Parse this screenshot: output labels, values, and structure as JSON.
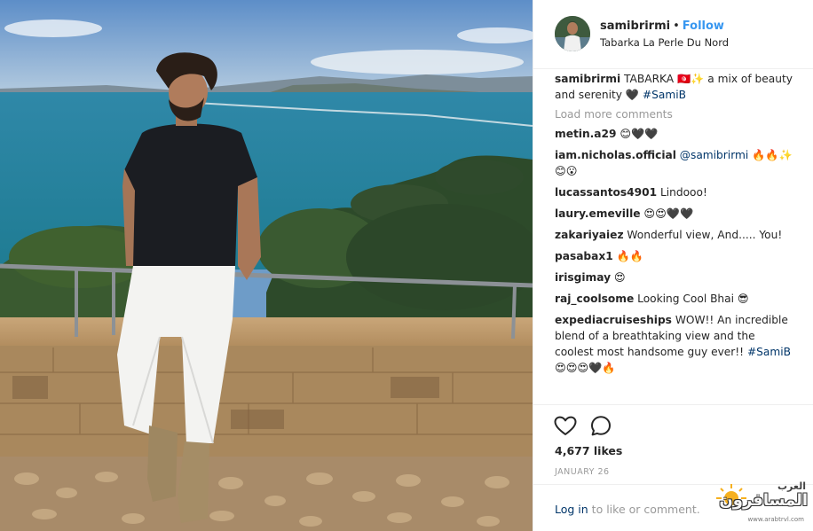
{
  "post": {
    "image_alt": "Man in black t-shirt and white jeans leaning on a railing overlooking the sea",
    "header": {
      "username": "samibrirmi",
      "separator": "•",
      "follow_label": "Follow",
      "location": "Tabarka La Perle Du Nord"
    },
    "caption": {
      "username": "samibrirmi",
      "text": "TABARKA 🇹🇳✨ a mix of beauty and serenity 🖤",
      "hashtag": "#SamiB"
    },
    "load_more_label": "Load more comments",
    "comments": [
      {
        "username": "metin.a29",
        "text": "😊🖤🖤"
      },
      {
        "username": "iam.nicholas.official",
        "mention": "@samibrirmi",
        "text": "🔥🔥✨😊😮"
      },
      {
        "username": "lucassantos4901",
        "text": "Lindooo!"
      },
      {
        "username": "laury.emeville",
        "text": "😍😍🖤🖤"
      },
      {
        "username": "zakariyaiez",
        "text": "Wonderful view, And..... You!"
      },
      {
        "username": "pasabax1",
        "text": "🔥🔥"
      },
      {
        "username": "irisgimay",
        "text": "😍"
      },
      {
        "username": "raj_coolsome",
        "text": "Looking Cool Bhai 😎"
      },
      {
        "username": "expediacruiseships",
        "text": "WOW!! An incredible blend of a breathtaking view and the coolest most handsome guy ever!!",
        "hashtag": "#SamiB",
        "suffix": "😍😍😍🖤🔥"
      }
    ],
    "likes": "4,677 likes",
    "date": "JANUARY 26",
    "login": {
      "link_label": "Log in",
      "text": " to like or comment."
    },
    "icons": {
      "like": "heart-icon",
      "comment": "comment-bubble-icon"
    },
    "watermark": {
      "main": "المسافرون",
      "small": "العرب",
      "url": "www.arabtrvl.com"
    },
    "colors": {
      "link_blue": "#3897f0",
      "tag_blue": "#003569",
      "muted": "#999999",
      "text": "#262626"
    }
  }
}
